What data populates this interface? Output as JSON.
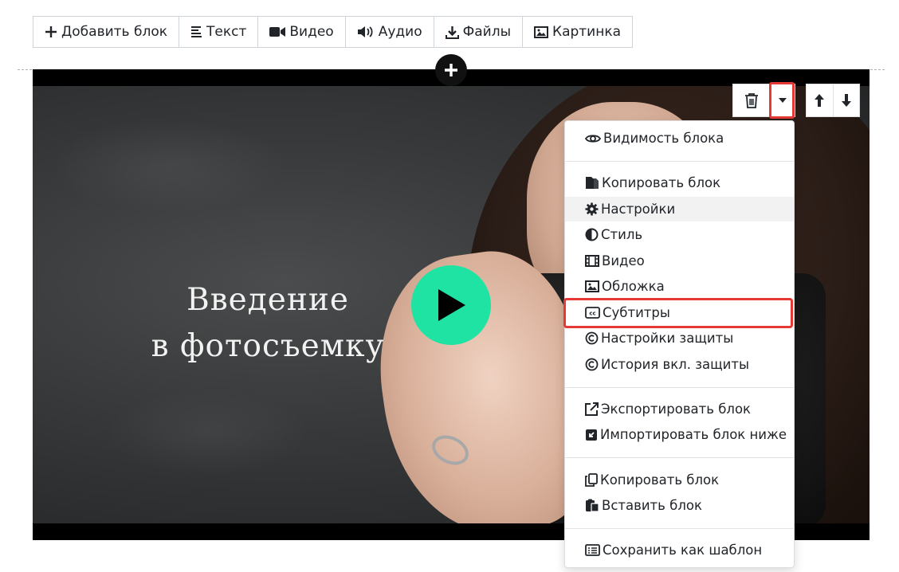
{
  "toolbar": {
    "add_block": "Добавить блок",
    "text": "Текст",
    "video": "Видео",
    "audio": "Аудио",
    "files": "Файлы",
    "image": "Картинка"
  },
  "video": {
    "title_line1": "Введение",
    "title_line2": "в фотосъемку",
    "play_color": "#1ee3a3"
  },
  "menu": {
    "visibility": "Видимость блока",
    "copy_block": "Копировать блок",
    "settings": "Настройки",
    "style": "Стиль",
    "video": "Видео",
    "cover": "Обложка",
    "subtitles": "Субтитры",
    "protection_settings": "Настройки защиты",
    "protection_history": "История вкл. защиты",
    "export_block": "Экспортировать блок",
    "import_block_below": "Импортировать блок ниже",
    "copy_block_2": "Копировать блок",
    "paste_block": "Вставить блок",
    "save_as_template": "Сохранить как шаблон"
  },
  "highlight_color": "#e53935"
}
